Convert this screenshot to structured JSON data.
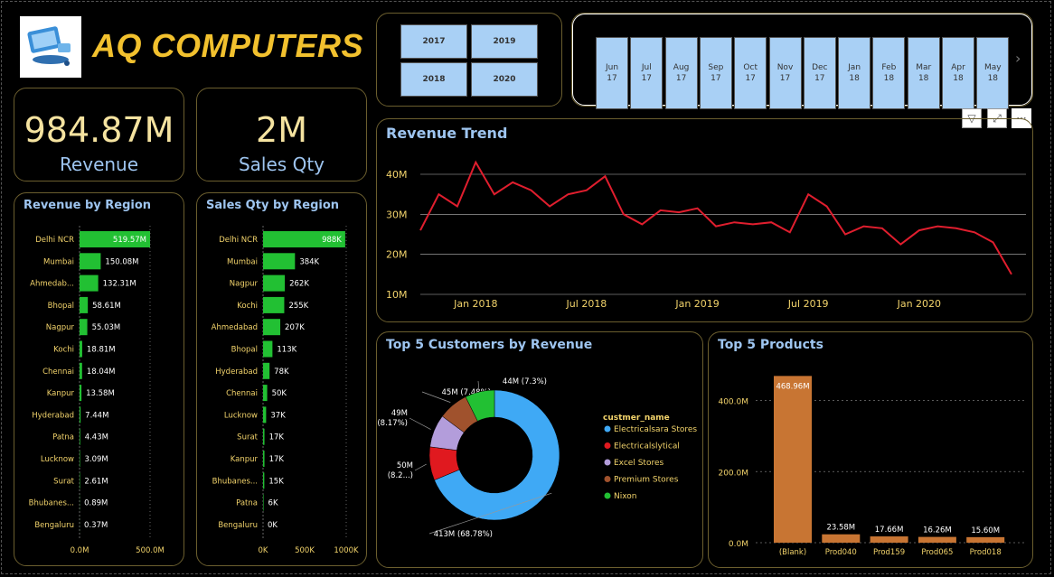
{
  "brand": {
    "title": "AQ COMPUTERS"
  },
  "kpis": {
    "revenue": {
      "value": "984.87M",
      "label": "Revenue"
    },
    "qty": {
      "value": "2M",
      "label": "Sales Qty"
    }
  },
  "years": [
    "2017",
    "2019",
    "2018",
    "2020"
  ],
  "months": [
    {
      "m": "Jun",
      "y": "17"
    },
    {
      "m": "Jul",
      "y": "17"
    },
    {
      "m": "Aug",
      "y": "17"
    },
    {
      "m": "Sep",
      "y": "17"
    },
    {
      "m": "Oct",
      "y": "17"
    },
    {
      "m": "Nov",
      "y": "17"
    },
    {
      "m": "Dec",
      "y": "17"
    },
    {
      "m": "Jan",
      "y": "18"
    },
    {
      "m": "Feb",
      "y": "18"
    },
    {
      "m": "Mar",
      "y": "18"
    },
    {
      "m": "Apr",
      "y": "18"
    },
    {
      "m": "May",
      "y": "18"
    }
  ],
  "month_next": "›",
  "toolbar": {
    "filter": "▽",
    "focus": "⤢",
    "more": "···"
  },
  "colors": {
    "accent": "#f2c12e",
    "title": "#9ec5f0",
    "bar": "#22c033",
    "product_bar": "#c87533",
    "line": "#e01e2e",
    "panel_border": "#6b5e2e"
  },
  "chart_data": [
    {
      "id": "revenue_by_region",
      "type": "bar",
      "orientation": "horizontal",
      "title": "Revenue by Region",
      "categories": [
        "Delhi NCR",
        "Mumbai",
        "Ahmedab...",
        "Bhopal",
        "Nagpur",
        "Kochi",
        "Chennai",
        "Kanpur",
        "Hyderabad",
        "Patna",
        "Lucknow",
        "Surat",
        "Bhubanes...",
        "Bengaluru"
      ],
      "values": [
        519.57,
        150.08,
        132.31,
        58.61,
        55.03,
        18.81,
        18.04,
        13.58,
        7.44,
        4.43,
        3.09,
        2.61,
        0.89,
        0.37
      ],
      "labels": [
        "519.57M",
        "150.08M",
        "132.31M",
        "58.61M",
        "55.03M",
        "18.81M",
        "18.04M",
        "13.58M",
        "7.44M",
        "4.43M",
        "3.09M",
        "2.61M",
        "0.89M",
        "0.37M"
      ],
      "xticks": [
        "0.0M",
        "500.0M"
      ],
      "xlim": [
        0,
        500
      ]
    },
    {
      "id": "qty_by_region",
      "type": "bar",
      "orientation": "horizontal",
      "title": "Sales Qty by Region",
      "categories": [
        "Delhi NCR",
        "Mumbai",
        "Nagpur",
        "Kochi",
        "Ahmedabad",
        "Bhopal",
        "Hyderabad",
        "Chennai",
        "Lucknow",
        "Surat",
        "Kanpur",
        "Bhubanes...",
        "Patna",
        "Bengaluru"
      ],
      "values": [
        988,
        384,
        262,
        255,
        207,
        113,
        78,
        50,
        37,
        17,
        17,
        15,
        6,
        0
      ],
      "labels": [
        "988K",
        "384K",
        "262K",
        "255K",
        "207K",
        "113K",
        "78K",
        "50K",
        "37K",
        "17K",
        "17K",
        "15K",
        "6K",
        "0K"
      ],
      "xticks": [
        "0K",
        "500K",
        "1000K"
      ],
      "xlim": [
        0,
        1000
      ]
    },
    {
      "id": "revenue_trend",
      "type": "line",
      "title": "Revenue Trend",
      "x": [
        "2017-10",
        "2017-11",
        "2017-12",
        "2018-01",
        "2018-02",
        "2018-03",
        "2018-04",
        "2018-05",
        "2018-06",
        "2018-07",
        "2018-08",
        "2018-09",
        "2018-10",
        "2018-11",
        "2018-12",
        "2019-01",
        "2019-02",
        "2019-03",
        "2019-04",
        "2019-05",
        "2019-06",
        "2019-07",
        "2019-08",
        "2019-09",
        "2019-10",
        "2019-11",
        "2019-12",
        "2020-01",
        "2020-02",
        "2020-03",
        "2020-04",
        "2020-05",
        "2020-06"
      ],
      "values": [
        26,
        35,
        32,
        43,
        35,
        38,
        36,
        32,
        35,
        36,
        39.5,
        30,
        27.5,
        31,
        30.5,
        31.5,
        27,
        28,
        27.5,
        28,
        25.5,
        35,
        32,
        25,
        27,
        26.5,
        22.5,
        26,
        27,
        26.5,
        25.5,
        23,
        15
      ],
      "yticks": [
        "10M",
        "20M",
        "30M",
        "40M"
      ],
      "ylim": [
        10,
        40
      ],
      "xticks": [
        "Jan 2018",
        "Jul 2018",
        "Jan 2019",
        "Jul 2019",
        "Jan 2020"
      ]
    },
    {
      "id": "top_customers",
      "type": "pie",
      "donut": true,
      "title": "Top 5 Customers by Revenue",
      "legend_title": "custmer_name",
      "categories": [
        "Electricalsara Stores",
        "Electricalslytical",
        "Excel Stores",
        "Premium Stores",
        "Nixon"
      ],
      "values": [
        413,
        50,
        49,
        45,
        44
      ],
      "colors": [
        "#3fa9f5",
        "#e0191f",
        "#b39ddb",
        "#a0522d",
        "#22c033"
      ],
      "labels": [
        "413M (68.78%)",
        "50M (8.2...)",
        "49M (8.17%)",
        "45M (7.48%)",
        "44M (7.3%)"
      ]
    },
    {
      "id": "top_products",
      "type": "bar",
      "title": "Top 5 Products",
      "categories": [
        "(Blank)",
        "Prod040",
        "Prod159",
        "Prod065",
        "Prod018"
      ],
      "values": [
        468.96,
        23.58,
        17.66,
        16.26,
        15.6
      ],
      "labels": [
        "468.96M",
        "23.58M",
        "17.66M",
        "16.26M",
        "15.60M"
      ],
      "yticks": [
        "0.0M",
        "200.0M",
        "400.0M"
      ],
      "ylim": [
        0,
        480
      ]
    }
  ]
}
